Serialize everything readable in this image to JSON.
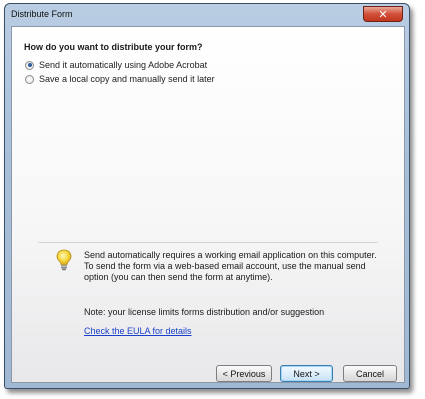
{
  "window": {
    "title": "Distribute Form",
    "close_symbol": "✕"
  },
  "question": "How do you want to distribute your form?",
  "options": [
    {
      "label": "Send it automatically using Adobe Acrobat",
      "selected": true
    },
    {
      "label": "Save a local copy and manually send it later",
      "selected": false
    }
  ],
  "info": {
    "icon": "lightbulb-icon",
    "message": "Send automatically requires a working email application on this computer. To send the form via a web-based email account, use the manual send option (you can then send the form at anytime).",
    "note": "Note: your license limits forms distribution and/or suggestion",
    "link": "Check the EULA for details"
  },
  "buttons": {
    "previous": "< Previous",
    "next": "Next >",
    "cancel": "Cancel"
  },
  "colors": {
    "link": "#1a3fc9",
    "radio_selected": "#2e5c99",
    "close_button": "#c2361f"
  }
}
